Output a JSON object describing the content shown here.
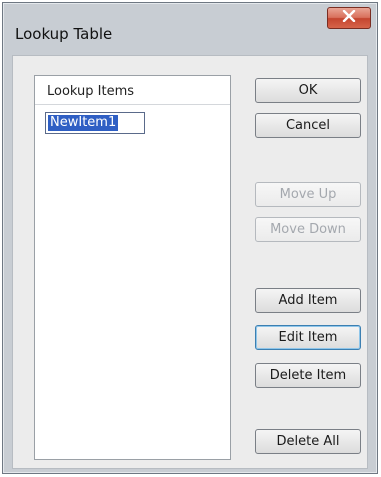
{
  "window": {
    "title": "Lookup Table",
    "close_glyph": "X"
  },
  "list": {
    "header": "Lookup Items",
    "editing_value": "NewItem1"
  },
  "buttons": {
    "ok": "OK",
    "cancel": "Cancel",
    "move_up": "Move Up",
    "move_down": "Move Down",
    "add_item": "Add Item",
    "edit_item": "Edit Item",
    "delete_item": "Delete Item",
    "delete_all": "Delete All"
  },
  "colors": {
    "close_button": "#c4452f",
    "selection": "#2f5fc4",
    "disabled_text": "#a4a8ae"
  }
}
